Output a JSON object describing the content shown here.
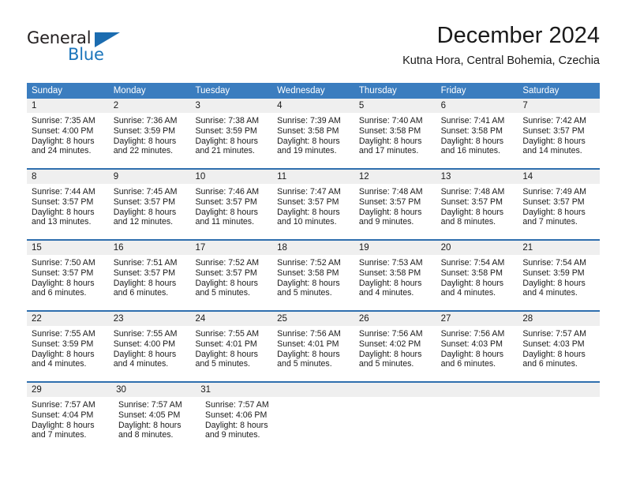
{
  "brand": {
    "name_top": "General",
    "name_bottom": "Blue",
    "triangle_color": "#1b6cb0",
    "blue_color": "#1b75bb"
  },
  "header": {
    "title": "December 2024",
    "subtitle": "Kutna Hora, Central Bohemia, Czechia"
  },
  "theme": {
    "header_bar_color": "#3b7dbf",
    "week_divider_color": "#2f6fae",
    "number_band_color": "#efefef",
    "text_color": "#1a1a1a"
  },
  "weekdays": [
    "Sunday",
    "Monday",
    "Tuesday",
    "Wednesday",
    "Thursday",
    "Friday",
    "Saturday"
  ],
  "weeks": [
    {
      "days": [
        {
          "num": "1",
          "sunrise": "Sunrise: 7:35 AM",
          "sunset": "Sunset: 4:00 PM",
          "daylight1": "Daylight: 8 hours",
          "daylight2": "and 24 minutes."
        },
        {
          "num": "2",
          "sunrise": "Sunrise: 7:36 AM",
          "sunset": "Sunset: 3:59 PM",
          "daylight1": "Daylight: 8 hours",
          "daylight2": "and 22 minutes."
        },
        {
          "num": "3",
          "sunrise": "Sunrise: 7:38 AM",
          "sunset": "Sunset: 3:59 PM",
          "daylight1": "Daylight: 8 hours",
          "daylight2": "and 21 minutes."
        },
        {
          "num": "4",
          "sunrise": "Sunrise: 7:39 AM",
          "sunset": "Sunset: 3:58 PM",
          "daylight1": "Daylight: 8 hours",
          "daylight2": "and 19 minutes."
        },
        {
          "num": "5",
          "sunrise": "Sunrise: 7:40 AM",
          "sunset": "Sunset: 3:58 PM",
          "daylight1": "Daylight: 8 hours",
          "daylight2": "and 17 minutes."
        },
        {
          "num": "6",
          "sunrise": "Sunrise: 7:41 AM",
          "sunset": "Sunset: 3:58 PM",
          "daylight1": "Daylight: 8 hours",
          "daylight2": "and 16 minutes."
        },
        {
          "num": "7",
          "sunrise": "Sunrise: 7:42 AM",
          "sunset": "Sunset: 3:57 PM",
          "daylight1": "Daylight: 8 hours",
          "daylight2": "and 14 minutes."
        }
      ]
    },
    {
      "days": [
        {
          "num": "8",
          "sunrise": "Sunrise: 7:44 AM",
          "sunset": "Sunset: 3:57 PM",
          "daylight1": "Daylight: 8 hours",
          "daylight2": "and 13 minutes."
        },
        {
          "num": "9",
          "sunrise": "Sunrise: 7:45 AM",
          "sunset": "Sunset: 3:57 PM",
          "daylight1": "Daylight: 8 hours",
          "daylight2": "and 12 minutes."
        },
        {
          "num": "10",
          "sunrise": "Sunrise: 7:46 AM",
          "sunset": "Sunset: 3:57 PM",
          "daylight1": "Daylight: 8 hours",
          "daylight2": "and 11 minutes."
        },
        {
          "num": "11",
          "sunrise": "Sunrise: 7:47 AM",
          "sunset": "Sunset: 3:57 PM",
          "daylight1": "Daylight: 8 hours",
          "daylight2": "and 10 minutes."
        },
        {
          "num": "12",
          "sunrise": "Sunrise: 7:48 AM",
          "sunset": "Sunset: 3:57 PM",
          "daylight1": "Daylight: 8 hours",
          "daylight2": "and 9 minutes."
        },
        {
          "num": "13",
          "sunrise": "Sunrise: 7:48 AM",
          "sunset": "Sunset: 3:57 PM",
          "daylight1": "Daylight: 8 hours",
          "daylight2": "and 8 minutes."
        },
        {
          "num": "14",
          "sunrise": "Sunrise: 7:49 AM",
          "sunset": "Sunset: 3:57 PM",
          "daylight1": "Daylight: 8 hours",
          "daylight2": "and 7 minutes."
        }
      ]
    },
    {
      "days": [
        {
          "num": "15",
          "sunrise": "Sunrise: 7:50 AM",
          "sunset": "Sunset: 3:57 PM",
          "daylight1": "Daylight: 8 hours",
          "daylight2": "and 6 minutes."
        },
        {
          "num": "16",
          "sunrise": "Sunrise: 7:51 AM",
          "sunset": "Sunset: 3:57 PM",
          "daylight1": "Daylight: 8 hours",
          "daylight2": "and 6 minutes."
        },
        {
          "num": "17",
          "sunrise": "Sunrise: 7:52 AM",
          "sunset": "Sunset: 3:57 PM",
          "daylight1": "Daylight: 8 hours",
          "daylight2": "and 5 minutes."
        },
        {
          "num": "18",
          "sunrise": "Sunrise: 7:52 AM",
          "sunset": "Sunset: 3:58 PM",
          "daylight1": "Daylight: 8 hours",
          "daylight2": "and 5 minutes."
        },
        {
          "num": "19",
          "sunrise": "Sunrise: 7:53 AM",
          "sunset": "Sunset: 3:58 PM",
          "daylight1": "Daylight: 8 hours",
          "daylight2": "and 4 minutes."
        },
        {
          "num": "20",
          "sunrise": "Sunrise: 7:54 AM",
          "sunset": "Sunset: 3:58 PM",
          "daylight1": "Daylight: 8 hours",
          "daylight2": "and 4 minutes."
        },
        {
          "num": "21",
          "sunrise": "Sunrise: 7:54 AM",
          "sunset": "Sunset: 3:59 PM",
          "daylight1": "Daylight: 8 hours",
          "daylight2": "and 4 minutes."
        }
      ]
    },
    {
      "days": [
        {
          "num": "22",
          "sunrise": "Sunrise: 7:55 AM",
          "sunset": "Sunset: 3:59 PM",
          "daylight1": "Daylight: 8 hours",
          "daylight2": "and 4 minutes."
        },
        {
          "num": "23",
          "sunrise": "Sunrise: 7:55 AM",
          "sunset": "Sunset: 4:00 PM",
          "daylight1": "Daylight: 8 hours",
          "daylight2": "and 4 minutes."
        },
        {
          "num": "24",
          "sunrise": "Sunrise: 7:55 AM",
          "sunset": "Sunset: 4:01 PM",
          "daylight1": "Daylight: 8 hours",
          "daylight2": "and 5 minutes."
        },
        {
          "num": "25",
          "sunrise": "Sunrise: 7:56 AM",
          "sunset": "Sunset: 4:01 PM",
          "daylight1": "Daylight: 8 hours",
          "daylight2": "and 5 minutes."
        },
        {
          "num": "26",
          "sunrise": "Sunrise: 7:56 AM",
          "sunset": "Sunset: 4:02 PM",
          "daylight1": "Daylight: 8 hours",
          "daylight2": "and 5 minutes."
        },
        {
          "num": "27",
          "sunrise": "Sunrise: 7:56 AM",
          "sunset": "Sunset: 4:03 PM",
          "daylight1": "Daylight: 8 hours",
          "daylight2": "and 6 minutes."
        },
        {
          "num": "28",
          "sunrise": "Sunrise: 7:57 AM",
          "sunset": "Sunset: 4:03 PM",
          "daylight1": "Daylight: 8 hours",
          "daylight2": "and 6 minutes."
        }
      ]
    },
    {
      "days": [
        {
          "num": "29",
          "sunrise": "Sunrise: 7:57 AM",
          "sunset": "Sunset: 4:04 PM",
          "daylight1": "Daylight: 8 hours",
          "daylight2": "and 7 minutes."
        },
        {
          "num": "30",
          "sunrise": "Sunrise: 7:57 AM",
          "sunset": "Sunset: 4:05 PM",
          "daylight1": "Daylight: 8 hours",
          "daylight2": "and 8 minutes."
        },
        {
          "num": "31",
          "sunrise": "Sunrise: 7:57 AM",
          "sunset": "Sunset: 4:06 PM",
          "daylight1": "Daylight: 8 hours",
          "daylight2": "and 9 minutes."
        },
        null,
        null,
        null,
        null
      ]
    }
  ]
}
